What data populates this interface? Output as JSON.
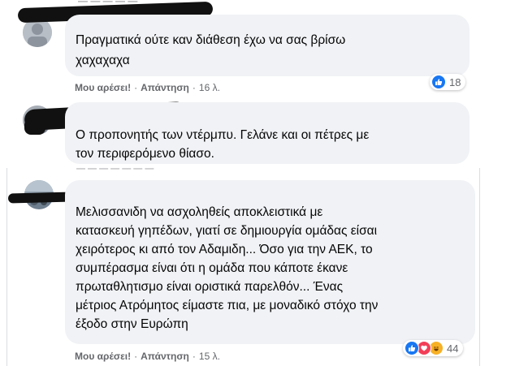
{
  "comments": [
    {
      "author": "",
      "lines": [
        "Πραγματικά ούτε καν διάθεση έχω να σας βρίσω",
        "χαχαχαχα"
      ],
      "like_label": "Μου αρέσει!",
      "reply_label": "Απάντηση",
      "time": "16 λ.",
      "reactions": {
        "types": [
          "like-icon"
        ],
        "count": "18"
      }
    },
    {
      "author": "",
      "lines": [
        "Ο προπονητής των ντέρμπυ. Γελάνε και οι πέτρες με",
        "τον περιφερόμενο θίασο."
      ],
      "like_label": "",
      "reply_label": "",
      "time": ""
    },
    {
      "author": "",
      "lines": [
        "Μελισσανιδη να ασχοληθείς αποκλειστικά με",
        "κατασκευή γηπέδων, γιατί σε δημιουργία ομάδας είσαι",
        "χειρότερος κι από τον Αδαμιδη... Όσο για την ΑΕΚ, το",
        "συμπέρασμα είναι ότι η ομάδα που κάποτε έκανε",
        "πρωταθλητισμο είναι οριστικά παρελθόν... Ένας",
        "μέτριος Ατρόμητος είμαστε πια, με μοναδικό στόχο την",
        "έξοδο στην Ευρώπη"
      ],
      "like_label": "Μου αρέσει!",
      "reply_label": "Απάντηση",
      "time": "15 λ.",
      "reactions": {
        "types": [
          "like-icon",
          "love-icon",
          "haha-icon"
        ],
        "count": "44"
      }
    }
  ],
  "colors": {
    "bubble": "#f0f2f5",
    "meta": "#65676b",
    "like": "#1877f2",
    "love": "#f33e58",
    "haha": "#f7b125"
  }
}
